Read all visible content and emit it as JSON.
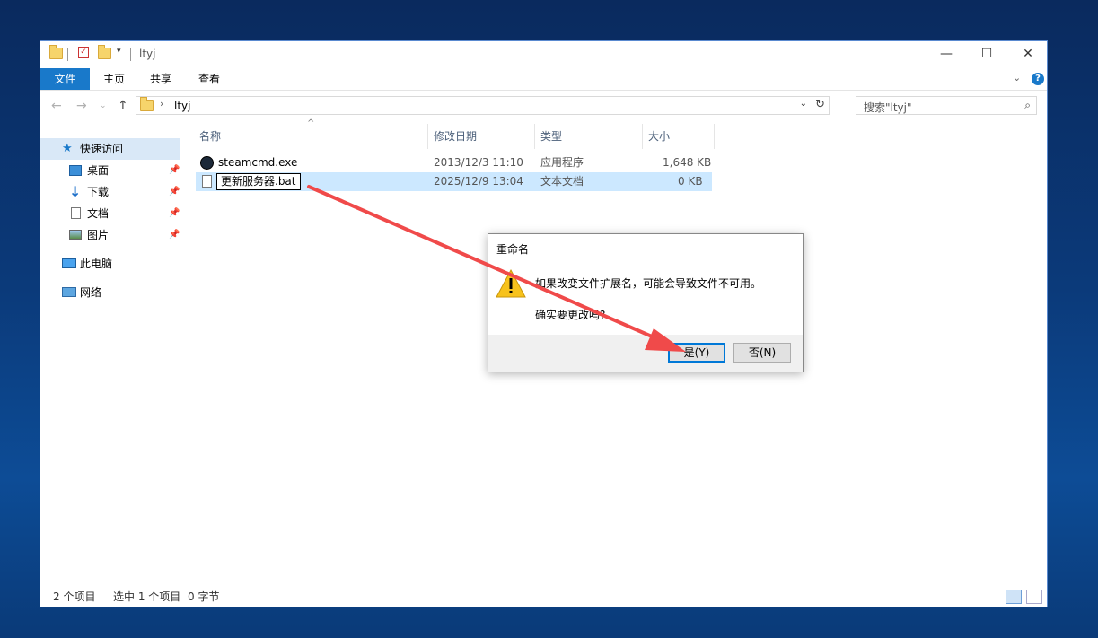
{
  "window": {
    "title": "ltyj",
    "controls": {
      "minimize": "—",
      "maximize": "☐",
      "close": "✕"
    }
  },
  "ribbon": {
    "tabs": [
      {
        "label": "文件"
      },
      {
        "label": "主页"
      },
      {
        "label": "共享"
      },
      {
        "label": "查看"
      }
    ],
    "help": "?"
  },
  "address": {
    "path": "ltyj",
    "search_placeholder": "搜索\"ltyj\""
  },
  "sidebar": {
    "items": [
      {
        "label": "快速访问",
        "icon": "star-icon"
      },
      {
        "label": "桌面",
        "icon": "desktop-icon",
        "pinned": true
      },
      {
        "label": "下载",
        "icon": "download-icon",
        "pinned": true
      },
      {
        "label": "文档",
        "icon": "document-icon",
        "pinned": true
      },
      {
        "label": "图片",
        "icon": "picture-icon",
        "pinned": true
      },
      {
        "label": "此电脑",
        "icon": "computer-icon"
      },
      {
        "label": "网络",
        "icon": "network-icon"
      }
    ]
  },
  "columns": {
    "name": "名称",
    "date": "修改日期",
    "type": "类型",
    "size": "大小"
  },
  "files": [
    {
      "name": "steamcmd.exe",
      "date": "2013/12/3 11:10",
      "type": "应用程序",
      "size": "1,648 KB",
      "icon": "steam-icon"
    },
    {
      "name": "更新服务器.bat",
      "date": "2025/12/9 13:04",
      "type": "文本文档",
      "size": "0 KB",
      "icon": "text-file-icon"
    }
  ],
  "status": {
    "count": "2 个项目",
    "selected": "选中 1 个项目",
    "size": "0 字节"
  },
  "dialog": {
    "title": "重命名",
    "message": "如果改变文件扩展名，可能会导致文件不可用。",
    "question": "确实要更改吗?",
    "yes": "是(Y)",
    "no": "否(N)"
  },
  "colors": {
    "accent": "#1979ca",
    "selection": "#cce8ff",
    "annotation_arrow": "#f04a4a"
  }
}
